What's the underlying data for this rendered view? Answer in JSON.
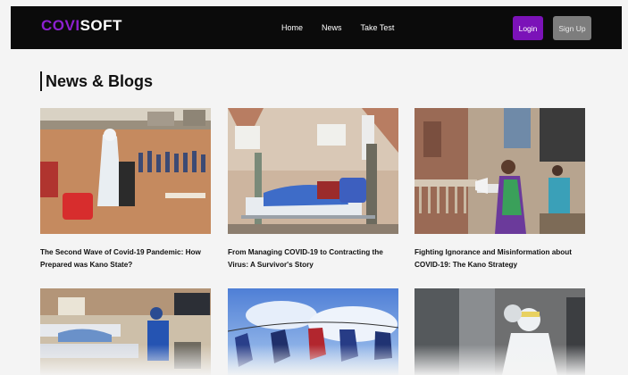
{
  "header": {
    "brand_part1": "COVI",
    "brand_part2": "SOFT",
    "nav": [
      "Home",
      "News",
      "Take Test"
    ],
    "login_label": "Login",
    "signup_label": "Sign Up"
  },
  "main": {
    "section_title": "News & Blogs",
    "articles": [
      {
        "title": "The Second Wave of Covid-19 Pandemic: How Prepared was Kano State?"
      },
      {
        "title": "From Managing COVID-19 to Contracting the Virus: A Survivor's Story"
      },
      {
        "title": "Fighting Ignorance and Misinformation about COVID-19: The Kano Strategy"
      }
    ]
  },
  "colors": {
    "accent": "#7b12b8",
    "navbar_bg": "#0b0b0b",
    "signup_bg": "#7d7d7d"
  }
}
